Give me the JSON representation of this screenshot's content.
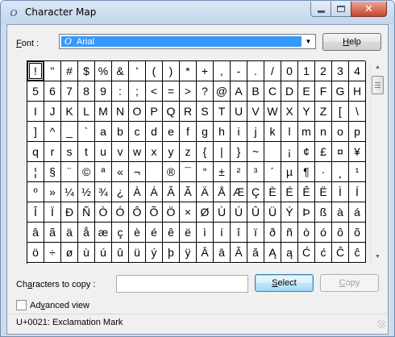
{
  "window": {
    "title": "Character Map",
    "close_glyph": "✕"
  },
  "font": {
    "label_accel": "F",
    "label_rest": "ont :",
    "selected": "Arial",
    "icon_glyph": "O",
    "arrow_glyph": "▼"
  },
  "buttons": {
    "help_accel": "H",
    "help_rest": "elp",
    "select_accel": "S",
    "select_rest": "elect",
    "copy_accel": "C",
    "copy_rest": "opy"
  },
  "characters": [
    "!",
    "\"",
    "#",
    "$",
    "%",
    "&",
    "'",
    "(",
    ")",
    "*",
    "+",
    ",",
    "-",
    ".",
    "/",
    "0",
    "1",
    "2",
    "3",
    "4",
    "5",
    "6",
    "7",
    "8",
    "9",
    ":",
    ";",
    "<",
    "=",
    ">",
    "?",
    "@",
    "A",
    "B",
    "C",
    "D",
    "E",
    "F",
    "G",
    "H",
    "I",
    "J",
    "K",
    "L",
    "M",
    "N",
    "O",
    "P",
    "Q",
    "R",
    "S",
    "T",
    "U",
    "V",
    "W",
    "X",
    "Y",
    "Z",
    "[",
    "\\",
    "]",
    "^",
    "_",
    "`",
    "a",
    "b",
    "c",
    "d",
    "e",
    "f",
    "g",
    "h",
    "i",
    "j",
    "k",
    "l",
    "m",
    "n",
    "o",
    "p",
    "q",
    "r",
    "s",
    "t",
    "u",
    "v",
    "w",
    "x",
    "y",
    "z",
    "{",
    "|",
    "}",
    "~",
    " ",
    "¡",
    "¢",
    "£",
    "¤",
    "¥",
    "¦",
    "§",
    "¨",
    "©",
    "ª",
    "«",
    "¬",
    "­",
    "®",
    "¯",
    "°",
    "±",
    "²",
    "³",
    "´",
    "µ",
    "¶",
    "·",
    "¸",
    "¹",
    "º",
    "»",
    "¼",
    "½",
    "¾",
    "¿",
    "À",
    "Á",
    "Â",
    "Ã",
    "Ä",
    "Å",
    "Æ",
    "Ç",
    "È",
    "É",
    "Ê",
    "Ë",
    "Ì",
    "Í",
    "Î",
    "Ï",
    "Ð",
    "Ñ",
    "Ò",
    "Ó",
    "Ô",
    "Õ",
    "Ö",
    "×",
    "Ø",
    "Ù",
    "Ú",
    "Û",
    "Ü",
    "Ý",
    "Þ",
    "ß",
    "à",
    "á",
    "â",
    "ã",
    "ä",
    "å",
    "æ",
    "ç",
    "è",
    "é",
    "ê",
    "ë",
    "ì",
    "í",
    "î",
    "ï",
    "ð",
    "ñ",
    "ò",
    "ó",
    "ô",
    "õ",
    "ö",
    "÷",
    "ø",
    "ù",
    "ú",
    "û",
    "ü",
    "ý",
    "þ",
    "ÿ",
    "Ā",
    "ā",
    "Ă",
    "ă",
    "Ą",
    "ą",
    "Ć",
    "ć",
    "Ĉ",
    "ĉ"
  ],
  "selected_index": 0,
  "copy": {
    "label_pre": "Ch",
    "label_accel": "a",
    "label_rest": "racters to copy :",
    "value": ""
  },
  "advanced": {
    "label_pre": "Ad",
    "label_accel": "v",
    "label_rest": "anced view",
    "checked": false
  },
  "status": {
    "text": "U+0021: Exclamation Mark"
  },
  "scrollbar": {
    "up_glyph": "▲",
    "down_glyph": "▼"
  }
}
